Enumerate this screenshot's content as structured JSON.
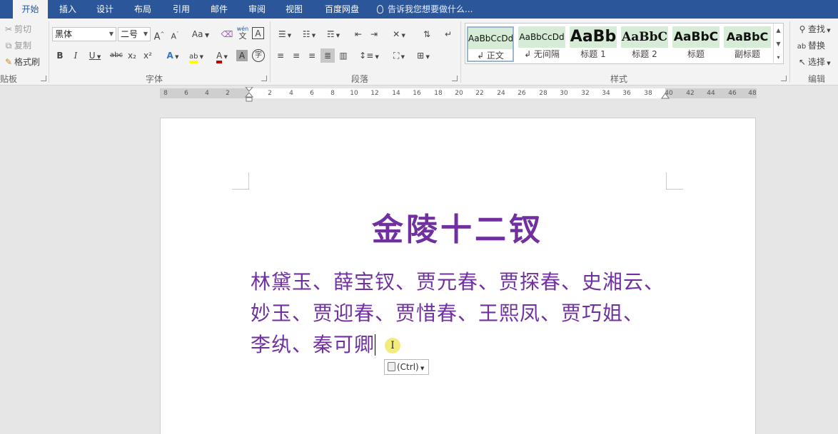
{
  "tabs": [
    {
      "label": "开始",
      "active": true
    },
    {
      "label": "插入"
    },
    {
      "label": "设计"
    },
    {
      "label": "布局"
    },
    {
      "label": "引用"
    },
    {
      "label": "邮件"
    },
    {
      "label": "审阅"
    },
    {
      "label": "视图"
    },
    {
      "label": "百度网盘"
    }
  ],
  "tell_me": "告诉我您想要做什么...",
  "clipboard": {
    "cut": "剪切",
    "copy": "复制",
    "format_painter": "格式刷",
    "group_label": "贴板"
  },
  "font": {
    "font_name": "黑体",
    "font_size": "二号",
    "group_label": "字体",
    "change_case": "Aa",
    "phonetic_top": "wén",
    "phonetic_char": "文",
    "border_char": "A",
    "bold": "B",
    "italic": "I",
    "underline": "U",
    "strike": "abc",
    "subscript": "x₂",
    "superscript": "x²",
    "effects": "A",
    "highlight": "ab",
    "font_color": "A",
    "shading": "A",
    "enclose": "字",
    "grow": "A",
    "shrink": "A"
  },
  "paragraph": {
    "group_label": "段落"
  },
  "styles": {
    "group_label": "样式",
    "items": [
      {
        "sample": "AaBbCcDd",
        "name": "↲ 正文"
      },
      {
        "sample": "AaBbCcDd",
        "name": "↲ 无间隔"
      },
      {
        "sample": "AaBb",
        "name": "标题 1"
      },
      {
        "sample": "AaBbC",
        "name": "标题 2"
      },
      {
        "sample": "AaBbC",
        "name": "标题"
      },
      {
        "sample": "AaBbC",
        "name": "副标题"
      }
    ]
  },
  "editing": {
    "find": "查找",
    "replace": "替换",
    "select": "选择",
    "group_label": "编辑"
  },
  "ruler": [
    "8",
    "6",
    "4",
    "2",
    "2",
    "4",
    "6",
    "8",
    "10",
    "12",
    "14",
    "16",
    "18",
    "20",
    "22",
    "24",
    "26",
    "28",
    "30",
    "32",
    "34",
    "36",
    "38",
    "40",
    "42",
    "44",
    "46",
    "48"
  ],
  "document": {
    "title": "金陵十二钗",
    "lines": [
      "林黛玉、薛宝钗、贾元春、贾探春、史湘云、",
      "妙玉、贾迎春、贾惜春、王熙凤、贾巧姐、",
      "李纨、秦可卿"
    ],
    "text_color": "#7030a0"
  },
  "paste_options": {
    "label": "(Ctrl)"
  },
  "colors": {
    "accent": "#2b579a",
    "ribbon_bg": "#f3f3f3",
    "highlight_yellow": "#ffff00",
    "font_color_red": "#c00000"
  }
}
